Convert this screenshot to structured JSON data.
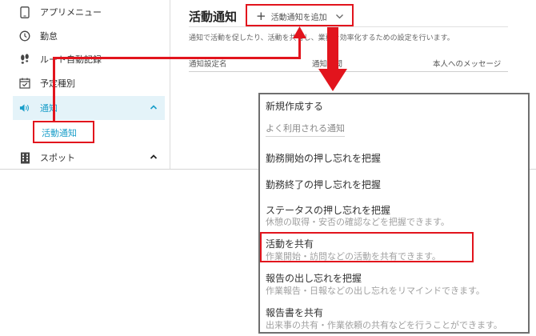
{
  "sidebar": {
    "items": [
      {
        "label": "アプリメニュー",
        "icon": "smartphone-icon"
      },
      {
        "label": "勤怠",
        "icon": "clock-icon"
      },
      {
        "label": "ルート自動記録",
        "icon": "footprints-icon"
      },
      {
        "label": "予定種別",
        "icon": "calendar-check-icon"
      },
      {
        "label": "通知",
        "icon": "speaker-icon",
        "expanded": true
      },
      {
        "label": "スポット",
        "icon": "building-icon",
        "expanded": true
      }
    ],
    "sub_item": "活動通知"
  },
  "main": {
    "title": "活動通知",
    "add_button": "活動通知を追加",
    "description": "通知で活動を促したり、活動を共有し、業務を効率化するための設定を行います。",
    "columns": [
      "通知設定名",
      "通知時間",
      "本人へのメッセージ"
    ]
  },
  "dropdown": {
    "new_label": "新規作成する",
    "frequent_label": "よく利用される通知",
    "options": [
      {
        "label": "勤務開始の押し忘れを把握",
        "sub": ""
      },
      {
        "label": "勤務終了の押し忘れを把握",
        "sub": ""
      },
      {
        "label": "ステータスの押し忘れを把握",
        "sub": "休憩の取得・安否の確認などを把握できます。"
      },
      {
        "label": "活動を共有",
        "sub": "作業開始・訪問などの活動を共有できます。"
      },
      {
        "label": "報告の出し忘れを把握",
        "sub": "作業報告・日報などの出し忘れをリマインドできます。"
      },
      {
        "label": "報告書を共有",
        "sub": "出来事の共有・作業依頼の共有などを行うことができます。"
      }
    ]
  },
  "colors": {
    "accent": "#1a9ec9",
    "active_bg": "#e4f3f9",
    "highlight": "#e2141d"
  }
}
